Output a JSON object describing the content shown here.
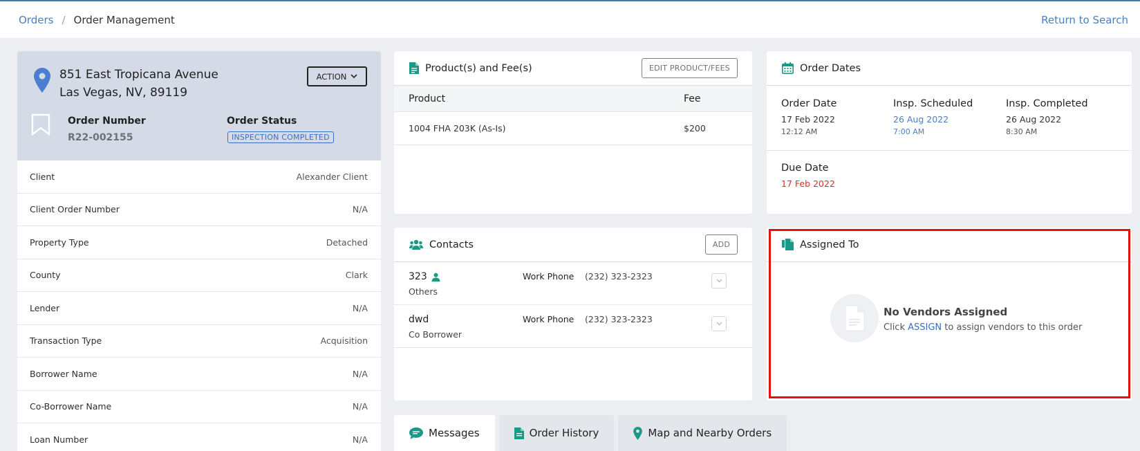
{
  "breadcrumb": {
    "root": "Orders",
    "separator": "/",
    "current": "Order Management"
  },
  "header": {
    "return_link": "Return to Search"
  },
  "order": {
    "address_line1": "851 East Tropicana Avenue",
    "address_line2": "Las Vegas, NV, 89119",
    "action_label": "ACTION",
    "order_number_label": "Order Number",
    "order_number": "R22-002155",
    "order_status_label": "Order Status",
    "order_status": "INSPECTION COMPLETED",
    "details": [
      {
        "label": "Client",
        "value": "Alexander Client"
      },
      {
        "label": "Client Order Number",
        "value": "N/A"
      },
      {
        "label": "Property Type",
        "value": "Detached"
      },
      {
        "label": "County",
        "value": "Clark"
      },
      {
        "label": "Lender",
        "value": "N/A"
      },
      {
        "label": "Transaction Type",
        "value": "Acquisition"
      },
      {
        "label": "Borrower Name",
        "value": "N/A"
      },
      {
        "label": "Co-Borrower Name",
        "value": "N/A"
      },
      {
        "label": "Loan Number",
        "value": "N/A"
      }
    ]
  },
  "products": {
    "title": "Product(s) and Fee(s)",
    "edit_label": "EDIT PRODUCT/FEES",
    "columns": [
      "Product",
      "Fee"
    ],
    "rows": [
      {
        "product": "1004 FHA 203K (As-Is)",
        "fee": "$200"
      }
    ]
  },
  "contacts": {
    "title": "Contacts",
    "add_label": "ADD",
    "rows": [
      {
        "name": "323",
        "role": "Others",
        "phone_label": "Work Phone",
        "phone": "(232) 323-2323"
      },
      {
        "name": "dwd",
        "role": "Co Borrower",
        "phone_label": "Work Phone",
        "phone": "(232) 323-2323"
      }
    ]
  },
  "dates": {
    "title": "Order Dates",
    "order_date": {
      "label": "Order Date",
      "day": "17 Feb 2022",
      "time": "12:12 AM"
    },
    "insp_scheduled": {
      "label": "Insp. Scheduled",
      "day": "26 Aug 2022",
      "time": "7:00 AM"
    },
    "insp_completed": {
      "label": "Insp. Completed",
      "day": "26 Aug 2022",
      "time": "8:30 AM"
    },
    "due_date": {
      "label": "Due Date",
      "day": "17 Feb 2022"
    }
  },
  "assigned": {
    "title": "Assigned To",
    "empty_title": "No Vendors Assigned",
    "empty_prefix": "Click",
    "assign_link": "ASSIGN",
    "empty_suffix": "to assign vendors to this order"
  },
  "tabs": [
    {
      "label": "Messages",
      "icon": "chat-icon"
    },
    {
      "label": "Order History",
      "icon": "document-icon"
    },
    {
      "label": "Map and Nearby Orders",
      "icon": "map-pin-icon"
    }
  ],
  "colors": {
    "accent": "#4a7fbf",
    "teal": "#1a9a86",
    "highlight": "#e51010",
    "due": "#e32b2b"
  }
}
